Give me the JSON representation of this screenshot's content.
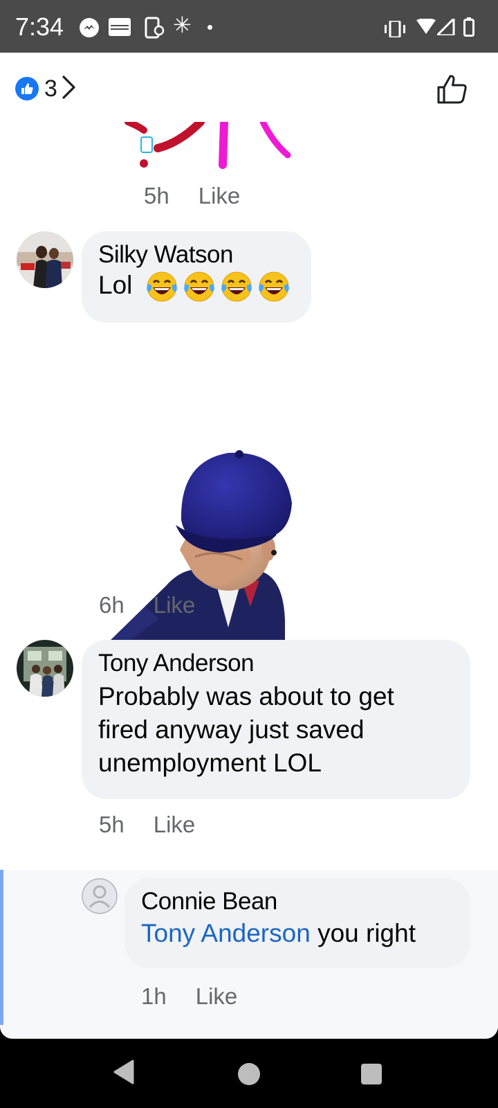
{
  "status_bar": {
    "time": "7:34",
    "icons": [
      "messenger-icon",
      "calendar-icon",
      "phone-sync-icon",
      "asterisk-icon",
      "dot-icon",
      "vibrate-icon",
      "wifi-icon",
      "signal-icon",
      "battery-icon"
    ]
  },
  "header": {
    "reaction_count": "3",
    "reaction_icon": "like-reaction-icon",
    "chevron_icon": "chevron-right-icon",
    "like_post_icon": "thumbs-up-outline-icon"
  },
  "comments": [
    {
      "type": "sticker",
      "time": "5h",
      "like_label": "Like"
    },
    {
      "author": "Silky Watson",
      "text": "Lol",
      "emoji": [
        "face-with-tears-of-joy",
        "face-with-tears-of-joy",
        "face-with-tears-of-joy",
        "face-with-tears-of-joy"
      ]
    },
    {
      "type": "sticker",
      "time": "6h",
      "like_label": "Like"
    },
    {
      "author": "Tony Anderson",
      "text_lines": [
        "Probably was about to get",
        "fired anyway just saved",
        "unemployment LOL"
      ],
      "time": "5h",
      "like_label": "Like"
    }
  ],
  "reply": {
    "author": "Connie Bean",
    "mention": "Tony Anderson",
    "text": " you right",
    "time": "1h",
    "like_label": "Like"
  },
  "colors": {
    "accent": "#1877f2",
    "mention": "#1a66c2",
    "bubble": "#f0f2f5",
    "meta_text": "#65676b",
    "status_bar": "#4a4a4a"
  },
  "nav_bar": {
    "icons": [
      "back-icon",
      "home-icon",
      "recents-icon"
    ]
  }
}
